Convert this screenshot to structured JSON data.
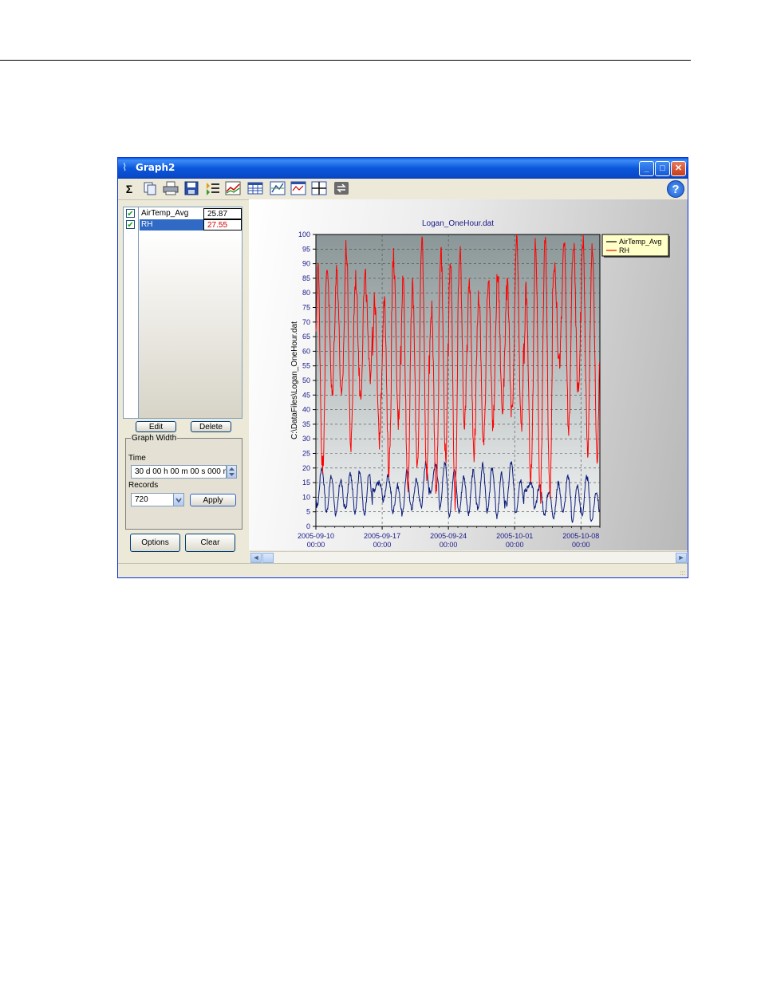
{
  "window": {
    "title": "Graph2",
    "controls": {
      "minimize": "_",
      "maximize": "□",
      "close": "✕"
    }
  },
  "toolbar": {
    "sigma_label": "Σ",
    "icons": [
      "sum-icon",
      "copy-icon",
      "print-icon",
      "save-icon",
      "trace-list-icon",
      "chart-options-icon",
      "table-icon",
      "scale-icon",
      "zoom-icon",
      "crosshair-icon",
      "refresh-icon"
    ],
    "help_label": "?"
  },
  "traces": [
    {
      "name": "AirTemp_Avg",
      "value": "25.87",
      "checked": true,
      "selected": false,
      "value_color": "#000000"
    },
    {
      "name": "RH",
      "value": "27.55",
      "checked": true,
      "selected": true,
      "value_color": "#d40000"
    }
  ],
  "buttons": {
    "edit": "Edit",
    "delete": "Delete",
    "apply": "Apply",
    "options": "Options",
    "clear": "Clear"
  },
  "graph_width": {
    "title": "Graph Width",
    "time_label": "Time",
    "time_value": "30 d 00 h 00 m 00 s 000 m",
    "records_label": "Records",
    "records_value": "720"
  },
  "scroll": {
    "left": "◄",
    "right": "►"
  },
  "status": {
    "grip": ":::"
  },
  "chart_data": {
    "type": "line",
    "title": "Logan_OneHour.dat",
    "ylabel": "C:\\DataFiles\\Logan_OneHour.dat",
    "xlabel": "",
    "ylim": [
      0,
      100
    ],
    "yticks": [
      0,
      5,
      10,
      15,
      20,
      25,
      30,
      35,
      40,
      45,
      50,
      55,
      60,
      65,
      70,
      75,
      80,
      85,
      90,
      95,
      100
    ],
    "xlim_days": [
      0,
      30
    ],
    "xticks": [
      {
        "day": 0,
        "label_date": "2005-09-10",
        "label_time": "00:00"
      },
      {
        "day": 7,
        "label_date": "2005-09-17",
        "label_time": "00:00"
      },
      {
        "day": 14,
        "label_date": "2005-09-24",
        "label_time": "00:00"
      },
      {
        "day": 21,
        "label_date": "2005-10-01",
        "label_time": "00:00"
      },
      {
        "day": 28,
        "label_date": "2005-10-08",
        "label_time": "00:00"
      }
    ],
    "grid": true,
    "legend": "top-right",
    "series": [
      {
        "name": "AirTemp_Avg",
        "legend_color": "#ffff00",
        "line_color": "#0a1a7a",
        "daily_min": [
          7,
          5,
          4,
          6,
          5,
          4,
          12,
          9,
          5,
          4,
          6,
          7,
          12,
          6,
          4,
          5,
          4,
          6,
          5,
          3,
          7,
          5,
          12,
          6,
          4,
          3,
          5,
          2,
          4,
          2
        ],
        "daily_max": [
          20,
          17,
          16,
          18,
          19,
          18,
          15,
          17,
          14,
          19,
          16,
          22,
          21,
          22,
          20,
          17,
          19,
          21,
          20,
          18,
          22,
          16,
          15,
          14,
          12,
          15,
          17,
          14,
          17,
          12
        ]
      },
      {
        "name": "RH",
        "legend_color": "#ff0000",
        "line_color": "#ff0000",
        "daily_min": [
          20,
          45,
          43,
          27,
          45,
          52,
          30,
          20,
          36,
          14,
          22,
          17,
          14,
          24,
          8,
          35,
          26,
          28,
          35,
          40,
          38,
          33,
          17,
          10,
          12,
          56,
          33,
          46,
          26,
          22
        ],
        "daily_max": [
          89,
          89,
          88,
          96,
          85,
          85,
          77,
          79,
          92,
          85,
          82,
          98,
          75,
          96,
          93,
          94,
          84,
          79,
          85,
          86,
          82,
          98,
          80,
          97,
          99,
          90,
          98,
          97,
          99,
          97
        ]
      }
    ]
  }
}
